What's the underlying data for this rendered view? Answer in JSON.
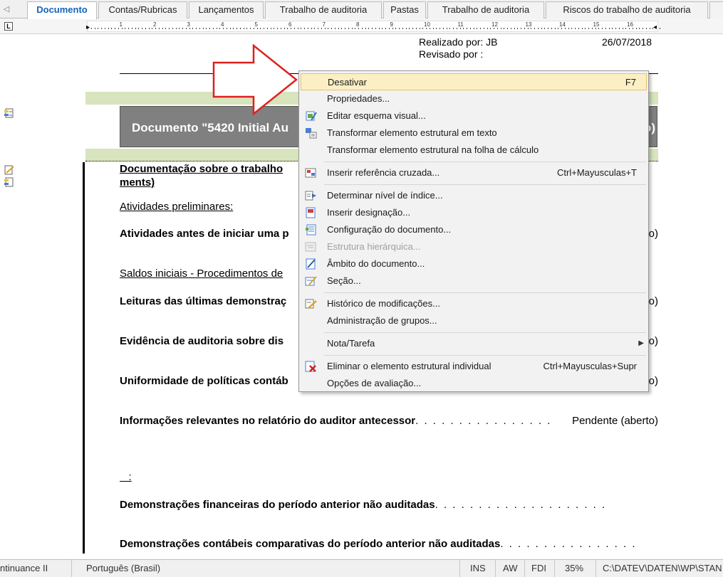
{
  "tabs": [
    {
      "label": "Documento",
      "active": true
    },
    {
      "label": "Contas/Rubricas"
    },
    {
      "label": "Lançamentos"
    },
    {
      "label": "Trabalho de auditoria"
    },
    {
      "label": "Pastas"
    },
    {
      "label": "Trabalho de auditoria"
    },
    {
      "label": "Riscos do trabalho de auditoria"
    }
  ],
  "ruler": {
    "corner_label": "L",
    "numbers": [
      "1",
      "2",
      "3",
      "4",
      "5",
      "6",
      "7",
      "8",
      "9",
      "10",
      "11",
      "12",
      "13",
      "14",
      "15",
      "16"
    ]
  },
  "document": {
    "realizado_label": "Realizado por: JB",
    "revisado_label": "Revisado por :",
    "date": "26/07/2018",
    "title": "Documento \"5420 Initial Au",
    "title_tail": "o)",
    "sections": [
      {
        "text": "Documentação sobre o trabalho",
        "style": "bold-underline"
      },
      {
        "text": "ments)",
        "style": "bold-underline"
      },
      {
        "text": "Atividades preliminares:",
        "style": "underline"
      },
      {
        "text": "Atividades antes de iniciar uma p",
        "style": "bold",
        "right": "o)"
      },
      {
        "text": "Saldos iniciais - Procedimentos de",
        "style": "underline"
      },
      {
        "text": "Leituras das últimas demonstraç",
        "style": "bold",
        "right": "o)"
      },
      {
        "text": "Evidência de auditoria sobre dis",
        "style": "bold",
        "right": "o)"
      },
      {
        "text": "Uniformidade de políticas contáb",
        "style": "bold",
        "right": "o)"
      },
      {
        "text": "Informações relevantes no relatório do auditor antecessor",
        "style": "bold",
        "dots": ". . . . . . . . . . . . . . . .",
        "right": "Pendente (aberto)"
      },
      {
        "text": ":",
        "style": "underline"
      },
      {
        "text": "Demonstrações financeiras do período anterior não auditadas",
        "style": "bold",
        "dots": ". . . . . . . . . . . . . . . . . . . ."
      },
      {
        "text": "Demonstrações contábeis comparativas do período anterior não auditadas",
        "style": "bold",
        "dots": ". . . . . . . . . . . . . . . ."
      }
    ]
  },
  "context_menu": {
    "items": [
      {
        "label": "Desativar",
        "shortcut": "F7",
        "icon": "none",
        "highlighted": true
      },
      {
        "label": "Propriedades...",
        "icon": "none"
      },
      {
        "label": "Editar esquema visual...",
        "icon": "edit-visual-icon"
      },
      {
        "label": "Transformar elemento estrutural em texto",
        "icon": "transform-text-icon"
      },
      {
        "label": "Transformar elemento estrutural na folha de cálculo",
        "icon": "none"
      },
      {
        "label": "Inserir referência cruzada...",
        "shortcut": "Ctrl+Mayusculas+T",
        "icon": "cross-reference-icon"
      },
      {
        "label": "Determinar nível de índice...",
        "icon": "index-level-icon"
      },
      {
        "label": "Inserir designação...",
        "icon": "designation-icon"
      },
      {
        "label": "Configuração do documento...",
        "icon": "document-config-icon"
      },
      {
        "label": "Estrutura hierárquica...",
        "icon": "hierarchy-icon",
        "disabled": true
      },
      {
        "label": "Âmbito do documento...",
        "icon": "document-scope-icon"
      },
      {
        "label": "Seção...",
        "icon": "section-icon"
      },
      {
        "label": "Histórico de modificações...",
        "icon": "history-icon"
      },
      {
        "label": "Administração de grupos...",
        "icon": "none"
      },
      {
        "label": "Nota/Tarefa",
        "icon": "none",
        "submenu": true
      },
      {
        "label": "Eliminar o elemento estrutural individual",
        "shortcut": "Ctrl+Mayusculas+Supr",
        "icon": "delete-element-icon"
      },
      {
        "label": "Opções de avaliação...",
        "icon": "none"
      }
    ]
  },
  "status_bar": {
    "left": "ntinuance II",
    "language": "Português (Brasil)",
    "ins": "INS",
    "aw": "AW",
    "fdi": "FDI",
    "zoom": "35%",
    "path": "C:\\DATEV\\DATEN\\WP\\STAN"
  },
  "colors": {
    "tab_active_text": "#1563b7",
    "green_band": "#d7e4bd",
    "title_box": "#808080",
    "menu_highlight": "#fcefc4",
    "arrow": "#e02020"
  }
}
